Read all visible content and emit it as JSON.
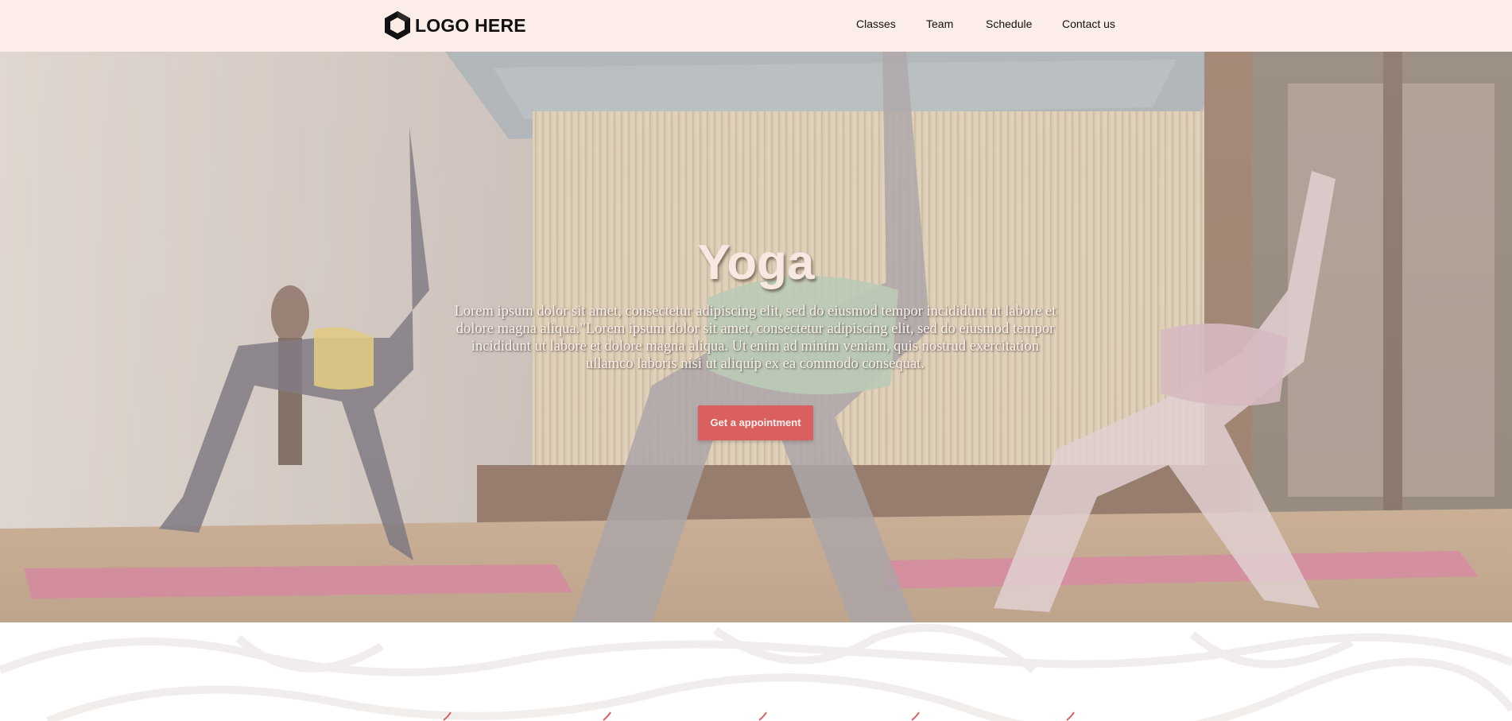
{
  "header": {
    "logo_text": "LOGO HERE",
    "logo_icon": "hexagon-logo-icon",
    "background_color": "#fdede8",
    "nav": [
      {
        "label": "Classes"
      },
      {
        "label": "Team"
      },
      {
        "label": "Schedule"
      },
      {
        "label": "Contact us"
      }
    ]
  },
  "hero": {
    "title": "Yoga",
    "text": "Lorem ipsum dolor sit amet, consectetur adipiscing elit, sed do eiusmod tempor incididunt ut labore et dolore magna aliqua.\"Lorem ipsum dolor sit amet, consectetur adipiscing elit, sed do eiusmod tempor incididunt ut labore et dolore magna aliqua. Ut enim ad minim veniam, quis nostrud exercitation ullamco laboris nisi ut aliquip ex ea commodo consequat.",
    "cta_label": "Get a appointment",
    "cta_color": "#d9605f"
  },
  "lower": {
    "decor_icon": "flourish-icon",
    "accent_color": "#d9605f"
  }
}
